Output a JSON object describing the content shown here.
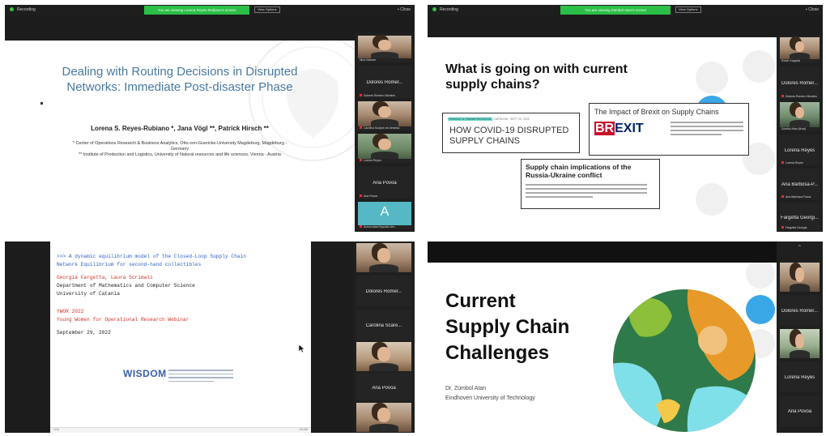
{
  "zoom": {
    "q1": {
      "recording": "Recording",
      "banner": "You are viewing Lorena Reyes-Rubiano's screen",
      "view_options": "View Options",
      "close": "Close",
      "slide": {
        "title_line1": "Dealing with Routing Decisions in Disrupted",
        "title_line2": "Networks: Immediate Post-disaster Phase",
        "authors": "Lorena S. Reyes-Rubiano *, Jana Vögl **, Patrick Hirsch **",
        "affil1_line1": "* Center of Operations Research & Business Analytics, Otto-von-Guericke-University Magdeburg, Magdeburg -",
        "affil1_line2": "Germany",
        "affil2": "** Institute of Production and Logistics, University of Natural resources and life sciences, Vienna - Austria"
      },
      "participants": [
        {
          "kind": "video",
          "label": "Nina Salman"
        },
        {
          "kind": "name",
          "name": "Dolores Romer...",
          "label": "Dolores Romero Morales"
        },
        {
          "kind": "video",
          "label": "Carolina Scarpin de Almeida"
        },
        {
          "kind": "video",
          "label": "Lorena Reyes"
        },
        {
          "kind": "name",
          "name": "Ana Povoa",
          "label": "Ana Povoa"
        },
        {
          "kind": "avatar",
          "initial": "A",
          "label": "Annunziata Esposito Am..."
        }
      ]
    },
    "q2": {
      "recording": "Recording",
      "banner": "You are viewing Zümbül Atan's screen",
      "view_options": "View Options",
      "close": "Close",
      "slide": {
        "title_line1": "What is going on with current",
        "title_line2": "supply chains?",
        "card1_kicker": "FREIGHT & TRANSPORTATION",
        "card1_meta": "CAROLINA · SEPT 20, 2022",
        "card1_title_line1": "HOW COVID-19 DISRUPTED",
        "card1_title_line2": "SUPPLY CHAINS",
        "card2_title": "The Impact of Brexit on Supply Chains",
        "card2_logo_a": "BR",
        "card2_logo_b": "EXIT",
        "card3_title_line1": "Supply chain implications of the",
        "card3_title_line2": "Russia-Ukraine conflict"
      },
      "participants": [
        {
          "kind": "video",
          "label": "Rober Kappels"
        },
        {
          "kind": "name",
          "name": "Dolores Romer...",
          "label": "Dolores Romero Morales"
        },
        {
          "kind": "video",
          "label": "Zumbul Atan (Host)"
        },
        {
          "kind": "name",
          "name": "Lorena Reyes",
          "label": "Lorena Reyes"
        },
        {
          "kind": "name",
          "name": "Ana Barbosa-P...",
          "label": "Ana Barbosa-Povoa"
        },
        {
          "kind": "name",
          "name": "Fargetta Georgi...",
          "label": "Fargetta Georgia"
        }
      ]
    },
    "q3": {
      "slide": {
        "line1": ">>> A dynamic equilibrium model of the Closed-Loop Supply Chain",
        "line2": "Network Equilibrium for second-hand collectibles",
        "authors": "Georgia Fargetta, Laura Scrimali",
        "dept": "Department of Mathematics and Computer Science",
        "univ": "University of Catania",
        "event1": "YWOR 2022",
        "event2": "Young Women for Operational Research Webinar",
        "date": "September 29, 2022",
        "logo": "WISDOM",
        "page_left": "1/16",
        "page_right": "13/168"
      },
      "participants": [
        {
          "kind": "video",
          "label": ""
        },
        {
          "kind": "name",
          "name": "Dolores Romer...",
          "label": ""
        },
        {
          "kind": "name",
          "name": "Carolina Scare...",
          "label": ""
        },
        {
          "kind": "video",
          "label": ""
        },
        {
          "kind": "name",
          "name": "Ana Povoa",
          "label": ""
        },
        {
          "kind": "video",
          "label": ""
        }
      ]
    },
    "q4": {
      "slide": {
        "title_line1": "Current",
        "title_line2": "Supply Chain",
        "title_line3": "Challenges",
        "presenter": "Dr. Zümbül Atan",
        "institution": "Eindhoven University of Technology"
      },
      "participants": [
        {
          "kind": "video",
          "label": ""
        },
        {
          "kind": "name",
          "name": "Dolores Romer...",
          "label": ""
        },
        {
          "kind": "video",
          "label": ""
        },
        {
          "kind": "name",
          "name": "Lorena Reyes",
          "label": ""
        },
        {
          "kind": "name",
          "name": "Ana Povoa",
          "label": ""
        }
      ]
    }
  },
  "colors": {
    "zoom_green": "#2bbf47",
    "slide1_title": "#4a78a0",
    "blue_circle": "#3aa7e6",
    "terminal_blue": "#2f62c8",
    "terminal_red": "#d2312b"
  },
  "icons": [
    "record-dot-icon",
    "close-icon",
    "mic-muted-icon",
    "cursor-icon",
    "chevron-up-icon"
  ]
}
